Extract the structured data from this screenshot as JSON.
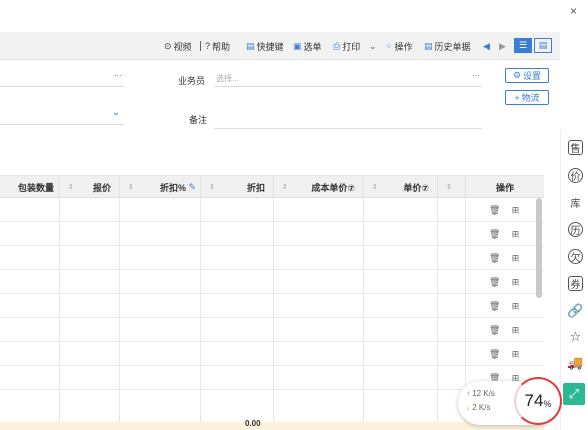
{
  "window": {
    "close_glyph": "×"
  },
  "toolbar": {
    "video": "视频",
    "help": "帮助",
    "shortcuts": "快捷键",
    "select_order": "选单",
    "print": "打印",
    "operations": "操作",
    "history": "历史单据"
  },
  "form": {
    "salesperson_label": "业务员",
    "salesperson_placeholder": "选择...",
    "remark_label": "备注",
    "settings_button": "设置",
    "logistics_button": "物流",
    "more_glyph": "···"
  },
  "table": {
    "columns": [
      "包装数量",
      "报价",
      "折扣%",
      "折扣",
      "成本单价⑦",
      "单价⑦",
      "操作"
    ],
    "footer_value": "0.00"
  },
  "netspeed": {
    "up": "12",
    "up_unit": "K/s",
    "down": "2",
    "down_unit": "K/s"
  },
  "gauge": {
    "value": "74",
    "unit": "%"
  },
  "right_rail": {
    "icons": [
      "售",
      "价",
      "库",
      "历",
      "欠",
      "券"
    ]
  }
}
